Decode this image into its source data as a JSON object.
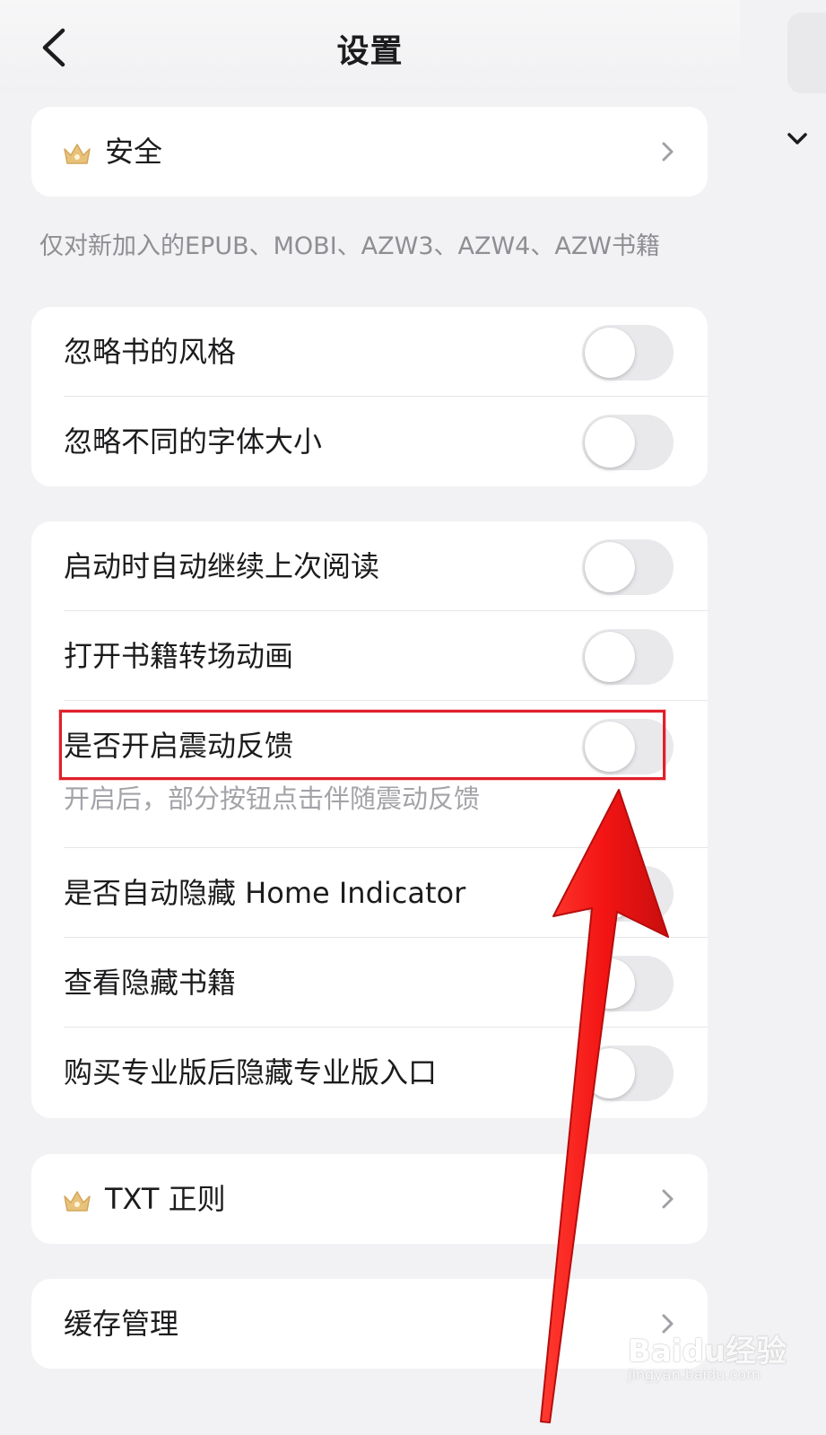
{
  "header": {
    "title": "设置",
    "back_icon": "chevron-left-icon"
  },
  "security_card": {
    "label": "安全",
    "icon": "crown-icon",
    "chevron": "chevron-right-icon"
  },
  "style_section": {
    "note": "仅对新加入的EPUB、MOBI、AZW3、AZW4、AZW书籍",
    "items": [
      {
        "label": "忽略书的风格",
        "on": false
      },
      {
        "label": "忽略不同的字体大小",
        "on": false
      }
    ]
  },
  "general_section": {
    "items": [
      {
        "label": "启动时自动继续上次阅读",
        "on": false
      },
      {
        "label": "打开书籍转场动画",
        "on": false
      },
      {
        "label": "是否开启震动反馈",
        "on": false,
        "sub": "开启后，部分按钮点击伴随震动反馈",
        "highlighted": true
      },
      {
        "label": "是否自动隐藏 Home Indicator",
        "on": false
      },
      {
        "label": "查看隐藏书籍",
        "on": false
      },
      {
        "label": "购买专业版后隐藏专业版入口",
        "on": false
      }
    ]
  },
  "txt_card": {
    "label": "TXT 正则",
    "icon": "crown-icon",
    "chevron": "chevron-right-icon"
  },
  "cache_card": {
    "label": "缓存管理",
    "chevron": "chevron-right-icon"
  },
  "annotation": {
    "arrow_color": "#f01d1d",
    "box_color": "#e0202a"
  },
  "watermark": {
    "brand": "Baidu经验",
    "url": "jingyan.baidu.com"
  }
}
